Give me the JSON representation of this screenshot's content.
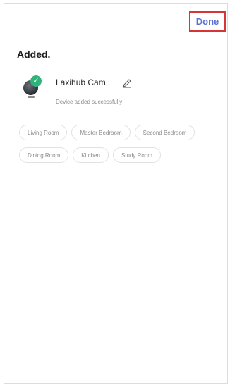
{
  "header": {
    "done_label": "Done"
  },
  "title": "Added.",
  "device": {
    "name": "Laxihub Cam",
    "status": "Device added successfully",
    "icon": "camera-icon",
    "badge_icon": "check-icon",
    "edit_icon": "pencil-icon"
  },
  "rooms": [
    "Living Room",
    "Master Bedroom",
    "Second Bedroom",
    "Dining Room",
    "Kitchen",
    "Study Room"
  ],
  "colors": {
    "accent": "#5a73d2",
    "highlight_border": "#d63535",
    "success_badge": "#2fb37a"
  }
}
